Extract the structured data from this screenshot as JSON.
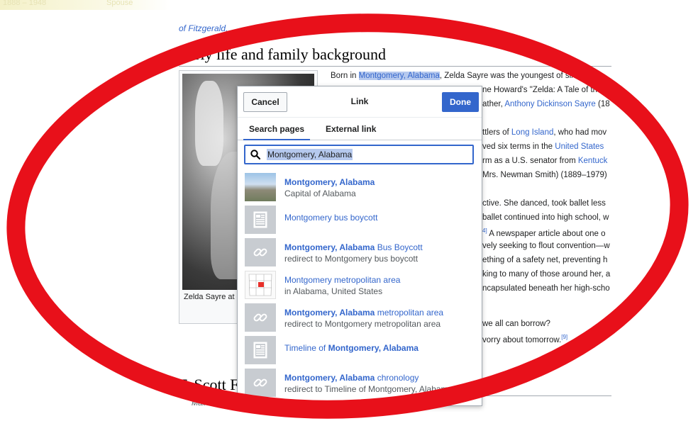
{
  "top_fade_text": [
    "1888 – 1948",
    "Spouse"
  ],
  "prev_link": "of Fitzgerald.",
  "section_early": "Early life and family background",
  "section_fitz": "F. Scott Fitzgerald",
  "main_article_note": "Main article: F. Scott Fitzgerald",
  "thumb_caption": "Zelda Sayre at 1… costume",
  "article": {
    "line1_pre": "Born in ",
    "line1_link": "Montgomery, Alabama",
    "line1_post": ", Zelda Sayre was the youngest of six chi",
    "clipped_lines": [
      {
        "pre": "",
        "text": "ne Howard's \"Zelda: A Tale of the M",
        "link": ""
      },
      {
        "pre": "ather, ",
        "link": "Anthony Dickinson Sayre",
        "text": " (18"
      },
      {
        "pre": "ttlers of ",
        "link": "Long Island",
        "text": ", who had mov"
      },
      {
        "pre": "ved six terms in the ",
        "link": "United States",
        "text": ""
      },
      {
        "pre": "rm as a U.S. senator from ",
        "link": "Kentuck",
        "text": ""
      },
      {
        "pre": "Mrs. Newman Smith) (1889–1979)",
        "link": "",
        "text": ""
      },
      {
        "pre": "ctive. She danced, took ballet less",
        "link": "",
        "text": ""
      },
      {
        "pre": "ballet continued into high school, w",
        "link": "",
        "text": ""
      },
      {
        "pre": "",
        "link": "",
        "text": " A newspaper article about one o",
        "sup": "4]"
      },
      {
        "pre": "vely seeking to flout convention—w",
        "link": "",
        "text": ""
      },
      {
        "pre": "ething of a safety net, preventing h",
        "link": "",
        "text": ""
      },
      {
        "pre": "king to many of those around her, a",
        "link": "",
        "text": ""
      },
      {
        "pre": "ncapsulated beneath her high-scho",
        "link": "",
        "text": ""
      },
      {
        "pre": "we all can borrow?",
        "link": "",
        "text": ""
      },
      {
        "pre": "vorry about tomorrow.",
        "link": "",
        "text": "",
        "sup": "[9]"
      }
    ]
  },
  "dialog": {
    "cancel_label": "Cancel",
    "title": "Link",
    "done_label": "Done",
    "tab_search": "Search pages",
    "tab_external": "External link",
    "search_value": "Montgomery, Alabama",
    "results": [
      {
        "bold": "Montgomery, Alabama",
        "rest": "",
        "desc": "Capital of Alabama",
        "icon": "city-photo-icon"
      },
      {
        "bold": "",
        "rest": "Montgomery bus boycott",
        "desc": "",
        "icon": "article-icon"
      },
      {
        "bold": "Montgomery, Alabama",
        "rest": " Bus Boycott",
        "desc": "redirect to Montgomery bus boycott",
        "icon": "redirect-link-icon"
      },
      {
        "bold": "",
        "rest": "Montgomery metropolitan area",
        "desc": "in Alabama, United States",
        "icon": "map-icon"
      },
      {
        "bold": "Montgomery, Alabama",
        "rest": " metropolitan area",
        "desc": "redirect to Montgomery metropolitan area",
        "icon": "redirect-link-icon"
      },
      {
        "pre": "Timeline of ",
        "bold": "Montgomery, Alabama",
        "rest": "",
        "desc": "",
        "icon": "article-icon"
      },
      {
        "bold": "Montgomery, Alabama",
        "rest": " chronology",
        "desc": "redirect to Timeline of Montgomery, Alabama",
        "icon": "redirect-link-icon"
      }
    ]
  },
  "colors": {
    "accent": "#3366cc",
    "annotation_ring": "#e8101a",
    "selection": "#b6c9ee"
  }
}
